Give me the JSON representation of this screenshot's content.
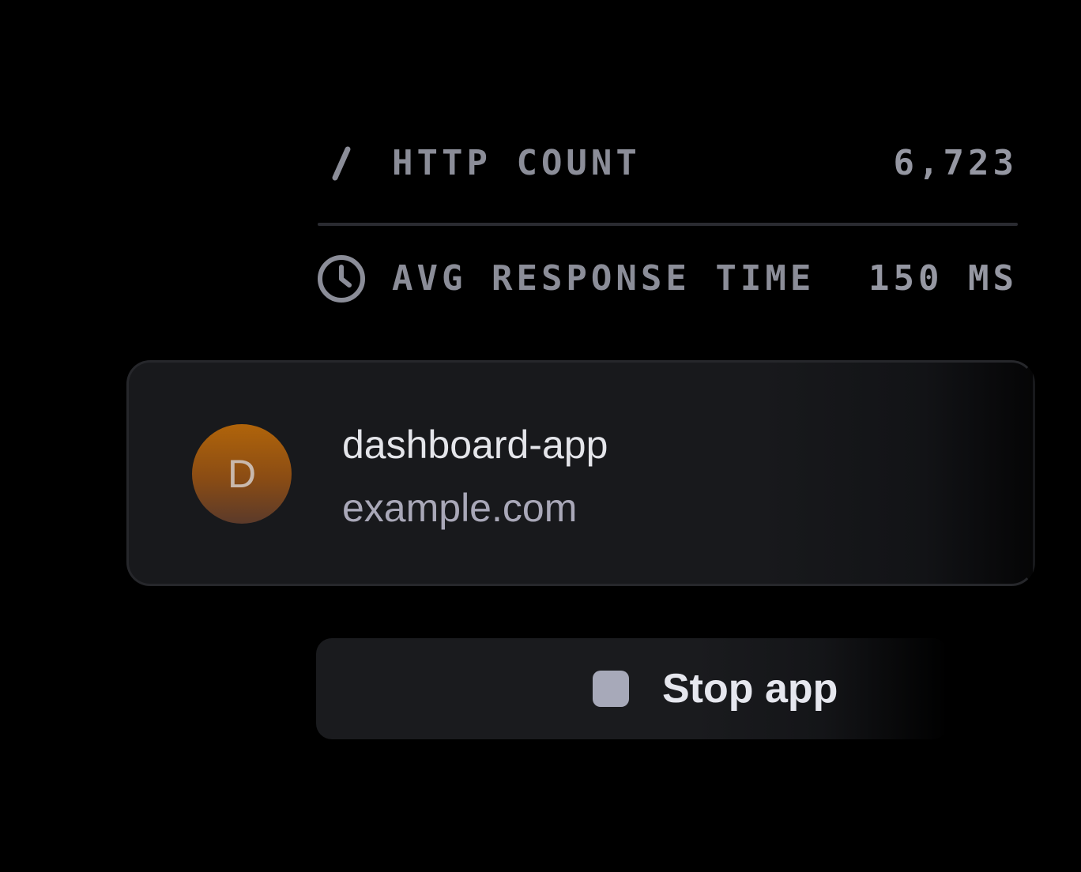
{
  "metrics": [
    {
      "icon": "slash-icon",
      "label": "HTTP COUNT",
      "value": "6,723"
    },
    {
      "icon": "clock-icon",
      "label": "AVG RESPONSE TIME",
      "value": "150 ms"
    }
  ],
  "app": {
    "avatar_letter": "D",
    "name": "dashboard-app",
    "domain": "example.com"
  },
  "actions": {
    "stop_icon": "stop-icon",
    "stop_label": "Stop app"
  },
  "colors": {
    "background": "#000000",
    "card": "#18191c",
    "avatar_accent": "#b0640a",
    "muted_text": "#8b8d98",
    "stop_icon": "#a7a9b9"
  }
}
